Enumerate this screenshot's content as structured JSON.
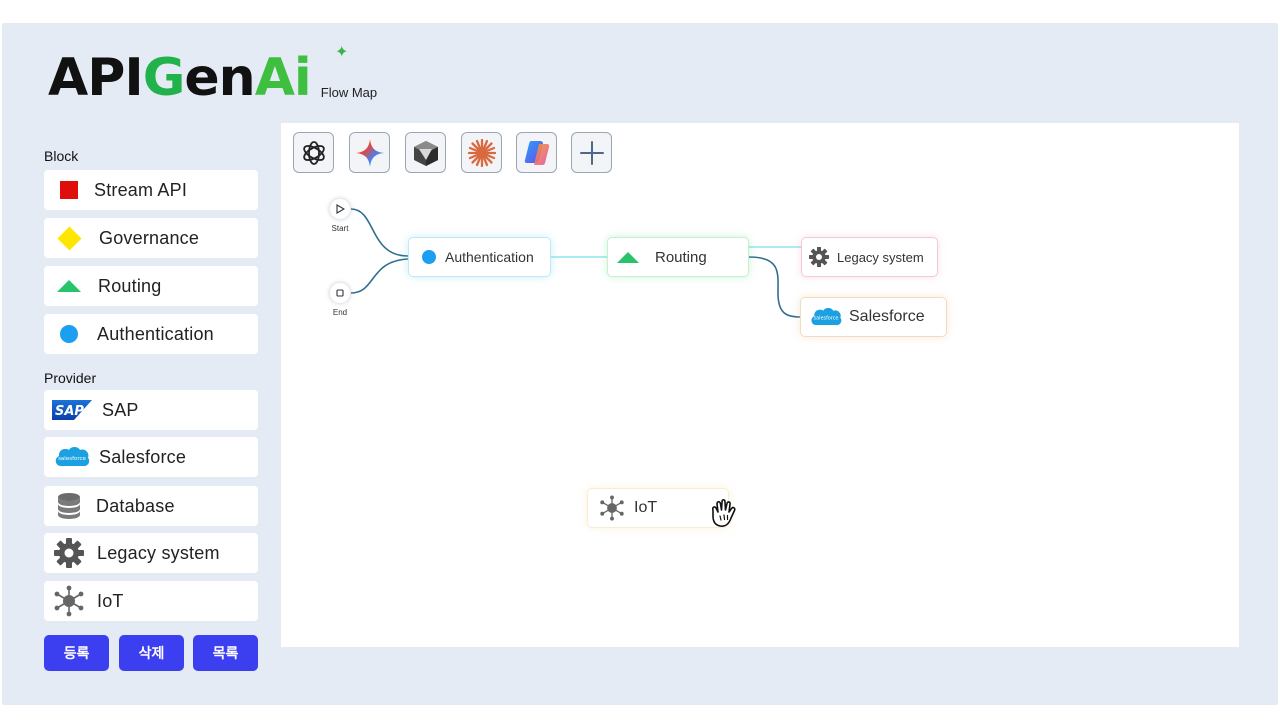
{
  "logo": {
    "api": "API",
    "g": "G",
    "en": "en",
    "ai": "Ai",
    "subtitle": "Flow Map"
  },
  "sidebar": {
    "block_title": "Block",
    "blocks": [
      {
        "label": "Stream API",
        "icon": "red-square-icon"
      },
      {
        "label": "Governance",
        "icon": "yellow-diamond-icon"
      },
      {
        "label": "Routing",
        "icon": "green-triangle-icon"
      },
      {
        "label": "Authentication",
        "icon": "blue-circle-icon"
      }
    ],
    "provider_title": "Provider",
    "providers": [
      {
        "label": "SAP",
        "icon": "sap-logo-icon"
      },
      {
        "label": "Salesforce",
        "icon": "salesforce-logo-icon"
      },
      {
        "label": "Database",
        "icon": "database-icon"
      },
      {
        "label": "Legacy system",
        "icon": "gear-icon"
      },
      {
        "label": "IoT",
        "icon": "iot-hub-icon"
      }
    ],
    "buttons": {
      "register": "등록",
      "delete": "삭제",
      "list": "목록"
    }
  },
  "toolbar": {
    "tools": [
      {
        "icon": "openai-icon"
      },
      {
        "icon": "gemini-sparkle-icon"
      },
      {
        "icon": "cube-icon"
      },
      {
        "icon": "claude-asterisk-icon"
      },
      {
        "icon": "copilot-icon"
      },
      {
        "icon": "plus-icon"
      }
    ]
  },
  "flow": {
    "start_label": "Start",
    "end_label": "End",
    "nodes": {
      "authentication": "Authentication",
      "routing": "Routing",
      "legacy": "Legacy system",
      "salesforce": "Salesforce",
      "iot": "IoT",
      "salesforce_logo_text": "salesforce",
      "sap_logo_text": "SAP"
    }
  },
  "colors": {
    "accent_button": "#3b3ff0",
    "stream_api": "#e00d0d",
    "governance": "#ffe600",
    "routing": "#27c46b",
    "authentication": "#1b9ff0",
    "panel_bg": "#e4ebf5"
  }
}
